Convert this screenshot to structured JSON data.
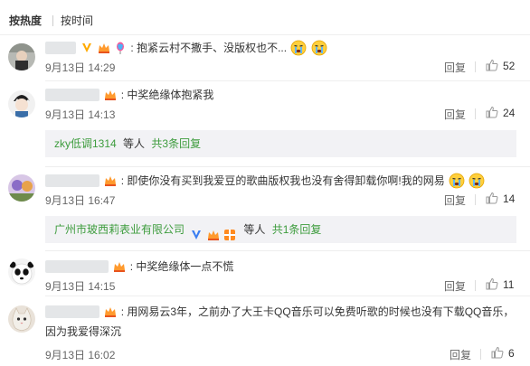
{
  "sort": {
    "hot": "按热度",
    "time": "按时间"
  },
  "comments": [
    {
      "content": "抱紧云村不撒手、没版权也不...",
      "time": "9月13日 14:29",
      "reply": "回复",
      "likes": "52"
    },
    {
      "content": "中奖绝缘体抱紧我",
      "time": "9月13日 14:13",
      "reply": "回复",
      "likes": "24",
      "sub": {
        "user": "zky低调1314",
        "middle": "等人",
        "link": "共3条回复"
      }
    },
    {
      "content": "即使你没有买到我爱豆的歌曲版权我也没有舍得卸载你啊!我的网易",
      "time": "9月13日 16:47",
      "reply": "回复",
      "likes": "14",
      "sub": {
        "user": "广州市玻西莉表业有限公司",
        "middle": "等人",
        "link": "共1条回复"
      }
    },
    {
      "content": "中奖绝缘体一点不慌",
      "time": "9月13日 14:15",
      "reply": "回复",
      "likes": "11"
    },
    {
      "content": "用网易云3年，之前办了大王卡QQ音乐可以免费听歌的时候也没有下载QQ音乐，",
      "content2": "因为我爱得深沉",
      "time": "9月13日 16:02",
      "reply": "回复",
      "likes": "6"
    }
  ],
  "colors": {
    "accent": "#eb7350",
    "link": "#3d9c3d",
    "vip": "#ffaa00"
  },
  "icons": [
    "crown-icon",
    "v-badge-icon",
    "balloon-icon",
    "crying-emoji-icon",
    "thumbs-up-icon",
    "gift-badge-icon"
  ]
}
